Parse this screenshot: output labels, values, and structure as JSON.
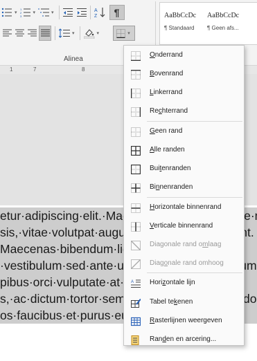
{
  "ribbon": {
    "group_label": "Alinea",
    "styles": [
      {
        "preview": "AaBbCcDc",
        "name": "¶ Standaard"
      },
      {
        "preview": "AaBbCcDc",
        "name": "¶ Geen afs..."
      }
    ],
    "icons_row1": [
      "bullets-icon",
      "numbering-icon",
      "multilevel-list-icon",
      "decrease-indent-icon",
      "increase-indent-icon",
      "sort-icon",
      "pilcrow-icon"
    ],
    "icons_row2": [
      "align-left-icon",
      "align-center-icon",
      "align-right-icon",
      "justify-icon",
      "line-spacing-icon",
      "shading-icon",
      "borders-icon"
    ]
  },
  "ruler": {
    "ticks": [
      "1",
      "7",
      "8"
    ]
  },
  "menu": {
    "items": [
      {
        "label": "Onderrand",
        "mnemonic": "O",
        "icon": "bottom-border-icon",
        "disabled": false
      },
      {
        "label": "Bovenrand",
        "mnemonic": "B",
        "icon": "top-border-icon",
        "disabled": false
      },
      {
        "label": "Linkerrand",
        "mnemonic": "L",
        "icon": "left-border-icon",
        "disabled": false
      },
      {
        "label": "Rechterrand",
        "mnemonic": "c",
        "icon": "right-border-icon",
        "disabled": false
      },
      {
        "label": "Geen rand",
        "mnemonic": "G",
        "icon": "no-border-icon",
        "disabled": false
      },
      {
        "label": "Alle randen",
        "mnemonic": "A",
        "icon": "all-borders-icon",
        "disabled": false
      },
      {
        "label": "Buitenranden",
        "mnemonic": "t",
        "icon": "outside-borders-icon",
        "disabled": false
      },
      {
        "label": "Binnenranden",
        "mnemonic": "n",
        "icon": "inside-borders-icon",
        "disabled": false
      },
      {
        "label": "Horizontale binnenrand",
        "mnemonic": "H",
        "icon": "inside-horizontal-border-icon",
        "disabled": false
      },
      {
        "label": "Verticale binnenrand",
        "mnemonic": "V",
        "icon": "inside-vertical-border-icon",
        "disabled": false
      },
      {
        "label": "Diagonale rand omlaag",
        "mnemonic": "m",
        "icon": "diagonal-down-border-icon",
        "disabled": true
      },
      {
        "label": "Diagonale rand omhoog",
        "mnemonic": "o",
        "icon": "diagonal-up-border-icon",
        "disabled": true
      },
      {
        "label": "Horizontale lijn",
        "mnemonic": "z",
        "icon": "horizontal-line-icon",
        "disabled": false
      },
      {
        "label": "Tabel tekenen",
        "mnemonic": "k",
        "icon": "draw-table-icon",
        "disabled": false
      },
      {
        "label": "Rasterlijnen weergeven",
        "mnemonic": "R",
        "icon": "view-gridlines-icon",
        "disabled": false
      },
      {
        "label": "Randen en arcering...",
        "mnemonic": "d",
        "icon": "borders-and-shading-icon",
        "disabled": false
      }
    ]
  },
  "document": {
    "lines": [
      "etur·adipiscing·elit.·Maecenas·porttitor·congue·massa.·rl",
      "sis,·vitae·volutpat·augue·placerat·nibh·nunc·nt.",
      "Maecenas·bibendum·ligula·eget·pede·ante·v",
      "·vestibulum·sed·ante·ut·lacinia·eros·sem·ipsum·me",
      "pibus·orci·vulputate·at·nisl·duis·sit·amet·n·s",
      "s,·ac·dictum·tortor·semper·ut·ultrices·commodo·Et",
      "os·faucibus·et·purus·eu·convallis"
    ]
  }
}
